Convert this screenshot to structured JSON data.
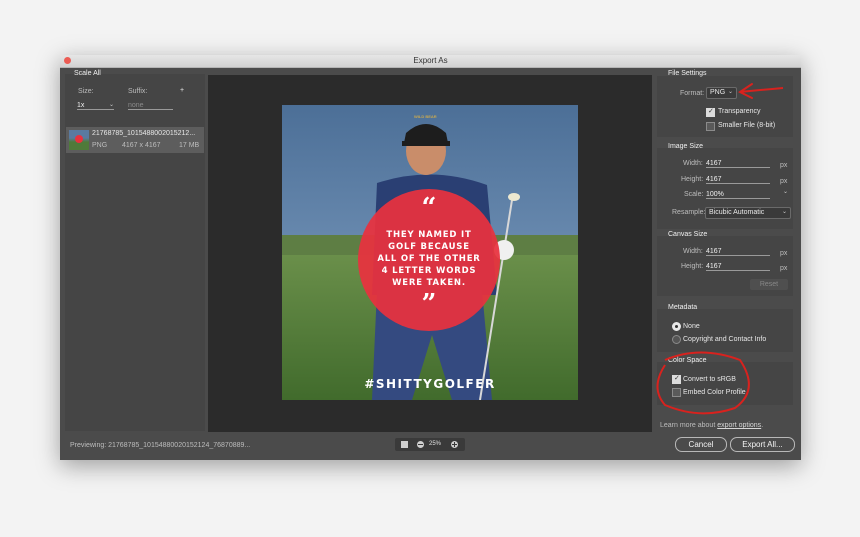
{
  "window": {
    "title": "Export As"
  },
  "scale_panel": {
    "header": "Scale All",
    "size_label": "Size:",
    "suffix_label": "Suffix:",
    "add_symbol": "+",
    "size_value": "1x",
    "suffix_placeholder": "none",
    "asset": {
      "name": "21768785_1015488002015212...",
      "format": "PNG",
      "dimensions": "4167 x 4167",
      "filesize": "17 MB"
    }
  },
  "preview": {
    "quote_open": "“",
    "quote_lines": [
      "THEY NAMED IT",
      "GOLF BECAUSE",
      "ALL OF THE OTHER",
      "4 LETTER WORDS",
      "WERE TAKEN."
    ],
    "quote_close": "”",
    "hashtag": "#SHITTYGOLFER",
    "cap_text": "WILD BEAR"
  },
  "file_settings": {
    "header": "File Settings",
    "format_label": "Format:",
    "format_value": "PNG",
    "transparency_label": "Transparency",
    "transparency_checked": true,
    "smaller_label": "Smaller File (8-bit)",
    "smaller_checked": false
  },
  "image_size": {
    "header": "Image Size",
    "width_label": "Width:",
    "width_value": "4167",
    "height_label": "Height:",
    "height_value": "4167",
    "scale_label": "Scale:",
    "scale_value": "100%",
    "resample_label": "Resample:",
    "resample_value": "Bicubic Automatic",
    "unit": "px"
  },
  "canvas_size": {
    "header": "Canvas Size",
    "width_label": "Width:",
    "width_value": "4167",
    "height_label": "Height:",
    "height_value": "4167",
    "unit": "px",
    "reset_label": "Reset"
  },
  "metadata": {
    "header": "Metadata",
    "option_none": "None",
    "option_copyright": "Copyright and Contact Info",
    "selected": "None"
  },
  "color_space": {
    "header": "Color Space",
    "convert_label": "Convert to sRGB",
    "convert_checked": true,
    "embed_label": "Embed Color Profile",
    "embed_checked": false
  },
  "footer": {
    "previewing_text": "Previewing: 21768785_10154880020152124_76870889...",
    "zoom_value": "25%",
    "learn_prefix": "Learn more about ",
    "learn_link": "export options",
    "learn_suffix": ".",
    "cancel_label": "Cancel",
    "export_label": "Export All..."
  },
  "colors": {
    "annotation_red": "#d8221e",
    "quote_circle": "#e8323e",
    "window_bg": "#4b4b4b"
  }
}
